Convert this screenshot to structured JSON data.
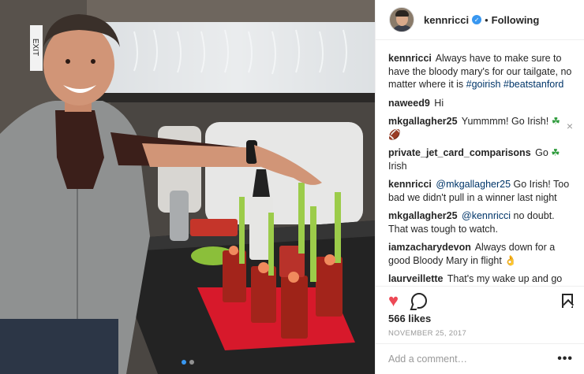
{
  "post": {
    "photo_alt": "",
    "carousel": {
      "count": 2,
      "active": 0
    }
  },
  "header": {
    "username": "kennricci",
    "separator": "•",
    "follow_label": "Following"
  },
  "comments": [
    {
      "user": "kennricci",
      "parts": [
        {
          "t": "Always have to make sure to have the bloody mary's for our tailgate, no matter where it is "
        },
        {
          "t": "#goirish",
          "tag": true
        },
        {
          "t": " "
        },
        {
          "t": "#beatstanford",
          "tag": true
        }
      ]
    },
    {
      "user": "naweed9",
      "parts": [
        {
          "t": "Hi"
        }
      ]
    },
    {
      "user": "mkgallagher25",
      "parts": [
        {
          "t": "Yummmm! Go Irish! "
        },
        {
          "t": "☘",
          "emoji": "clover"
        },
        {
          "t": " "
        },
        {
          "t": "🏈",
          "emoji": "football"
        }
      ]
    },
    {
      "user": "private_jet_card_comparisons",
      "parts": [
        {
          "t": "Go "
        },
        {
          "t": "☘",
          "emoji": "clover"
        },
        {
          "t": " Irish"
        }
      ]
    },
    {
      "user": "kennricci",
      "parts": [
        {
          "t": "@mkgallagher25",
          "tag": true
        },
        {
          "t": " Go Irish! Too bad we didn't pull in a winner last night"
        }
      ]
    },
    {
      "user": "mkgallagher25",
      "parts": [
        {
          "t": "@kennricci",
          "tag": true
        },
        {
          "t": " no doubt. That was tough to watch."
        }
      ]
    },
    {
      "user": "iamzacharydevon",
      "parts": [
        {
          "t": "Always down for a good Bloody Mary in flight "
        },
        {
          "t": "👌",
          "emoji": "hand"
        }
      ]
    },
    {
      "user": "laurveillette",
      "parts": [
        {
          "t": "That's my wake up and go drink. I'm ready to win the contest!"
        }
      ]
    }
  ],
  "actions": {
    "like_icon": "heart-icon",
    "comment_icon": "comment-icon",
    "save_icon": "bookmark-icon",
    "like_color": "#ed4956"
  },
  "likes_text": "566 likes",
  "date": "NOVEMBER 25, 2017",
  "add_comment": {
    "placeholder": "Add a comment…",
    "more_label": "•••"
  },
  "colors": {
    "accent": "#3897f0",
    "hashtag": "#003569",
    "muted": "#999999"
  }
}
